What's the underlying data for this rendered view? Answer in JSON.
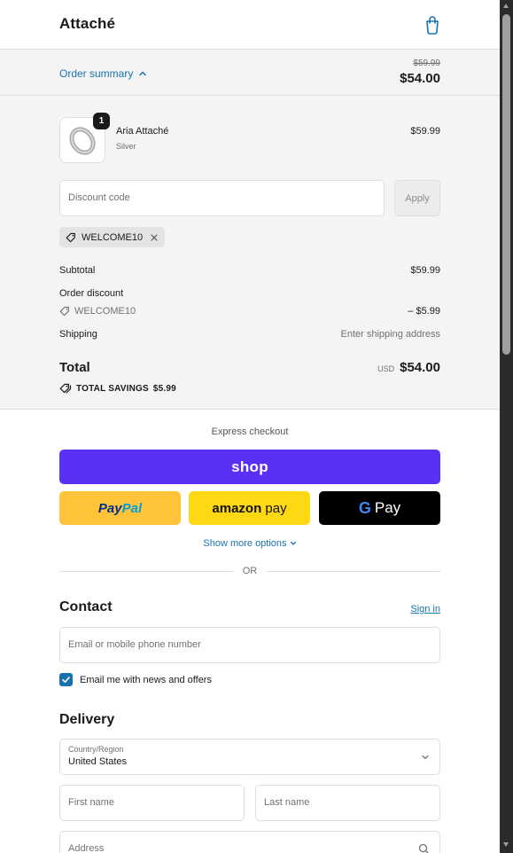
{
  "header": {
    "brand": "Attaché",
    "cart_icon": "shopping-bag-icon"
  },
  "summary": {
    "toggle_label": "Order summary",
    "toggle_icon": "chevron-up-icon",
    "original_total": "$59.99",
    "total": "$54.00",
    "product": {
      "name": "Aria Attaché",
      "variant": "Silver",
      "price": "$59.99",
      "quantity": "1",
      "image_icon": "ring-icon"
    },
    "discount": {
      "placeholder": "Discount code",
      "apply_label": "Apply"
    },
    "applied_code": "WELCOME10",
    "lines": {
      "subtotal_label": "Subtotal",
      "subtotal_value": "$59.99",
      "order_discount_label": "Order discount",
      "discount_code": "WELCOME10",
      "discount_value": "– $5.99",
      "shipping_label": "Shipping",
      "shipping_value": "Enter shipping address"
    },
    "total_label": "Total",
    "total_currency": "USD",
    "total_value": "$54.00",
    "savings_label": "TOTAL SAVINGS",
    "savings_value": "$5.99"
  },
  "express": {
    "title": "Express checkout",
    "shop_label": "shop",
    "paypal_part1": "Pay",
    "paypal_part2": "Pal",
    "amazon_word": "amazon",
    "amazon_pay": "pay",
    "gpay_g": "G",
    "gpay_pay": "Pay",
    "more_options": "Show more options",
    "or_text": "OR"
  },
  "contact": {
    "title": "Contact",
    "sign_in": "Sign in",
    "email_placeholder": "Email or mobile phone number",
    "newsletter_label": "Email me with news and offers",
    "newsletter_checked": true
  },
  "delivery": {
    "title": "Delivery",
    "country_label": "Country/Region",
    "country_value": "United States",
    "first_name_placeholder": "First name",
    "last_name_placeholder": "Last name",
    "address_placeholder": "Address"
  },
  "colors": {
    "accent": "#1773b0",
    "shop_purple": "#5a31f4",
    "paypal_yellow": "#ffc439",
    "amazon_yellow": "#ffd814"
  }
}
